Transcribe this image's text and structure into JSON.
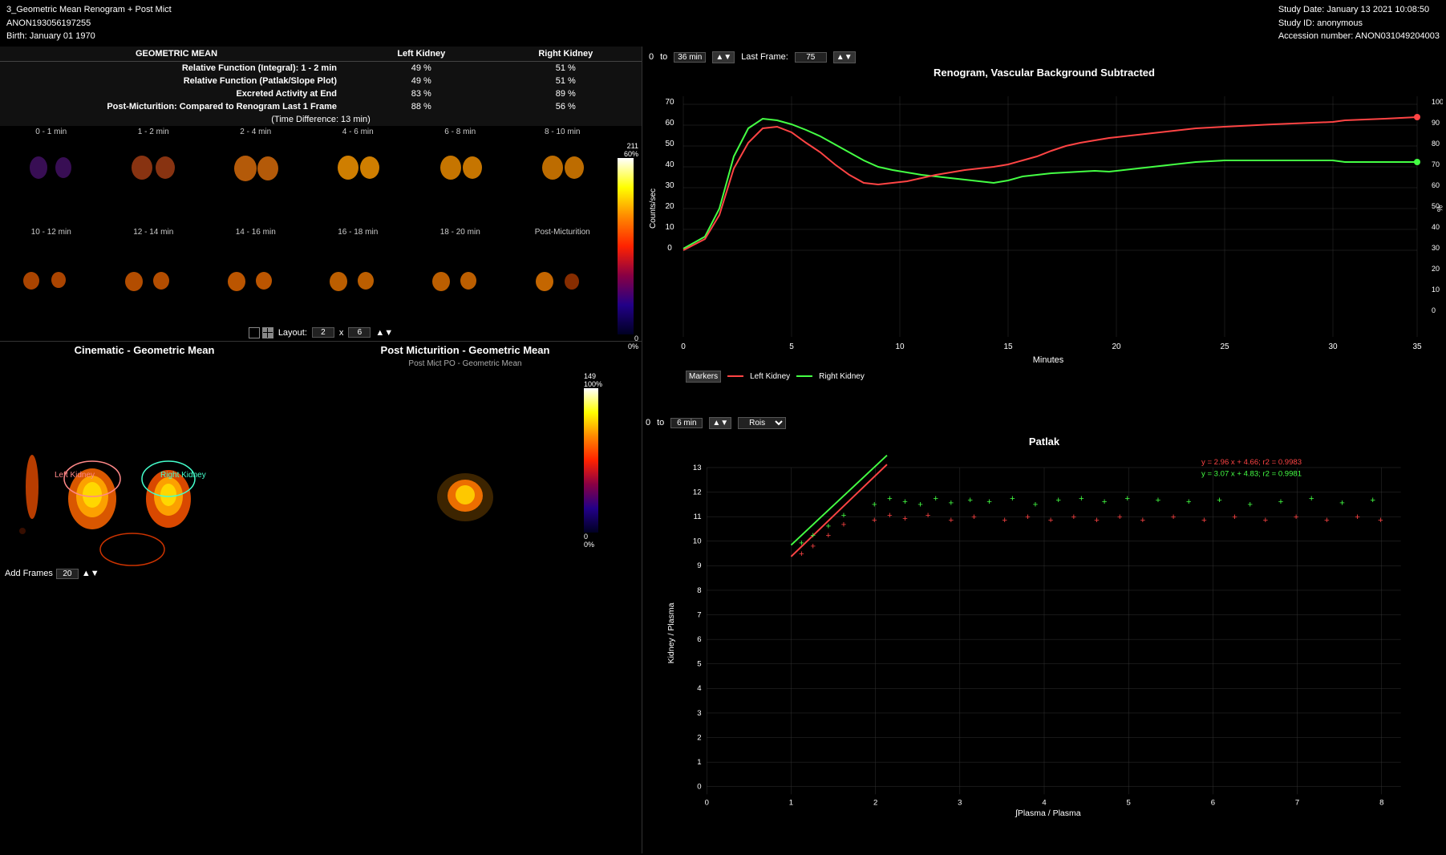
{
  "header": {
    "title": "3_Geometric Mean Renogram + Post Mict",
    "patient_id": "ANON193056197255",
    "birth": "Birth: January 01 1970",
    "study_date": "Study Date: January 13 2021 10:08:50",
    "study_id": "Study ID: anonymous",
    "accession": "Accession number: ANON031049204003"
  },
  "stats": {
    "title": "GEOMETRIC MEAN",
    "col_left": "Left Kidney",
    "col_right": "Right Kidney",
    "rows": [
      {
        "label": "Relative Function (Integral): 1 - 2 min",
        "left": "49 %",
        "right": "51 %"
      },
      {
        "label": "Relative Function (Patlak/Slope Plot)",
        "left": "49 %",
        "right": "51 %"
      },
      {
        "label": "Excreted Activity at End",
        "left": "83 %",
        "right": "89 %"
      },
      {
        "label": "Post-Micturition: Compared to Renogram Last 1 Frame",
        "left": "88 %",
        "right": "56 %"
      }
    ],
    "time_diff": "(Time Difference: 13 min)"
  },
  "frame_labels_row1": [
    "0 - 1 min",
    "1 - 2 min",
    "2 - 4 min",
    "4 - 6 min",
    "6 - 8 min",
    "8 - 10 min"
  ],
  "frame_labels_row2": [
    "10 - 12 min",
    "12 - 14 min",
    "14 - 16 min",
    "16 - 18 min",
    "18 - 20 min",
    "Post-Micturition"
  ],
  "color_scale_max": "211",
  "color_scale_pct": "60%",
  "color_scale_min": "0",
  "color_scale_0pct": "0%",
  "layout": {
    "label": "Layout:",
    "rows": "2",
    "cols": "6"
  },
  "cinematic": {
    "title": "Cinematic - Geometric Mean",
    "add_frames_label": "Add Frames",
    "add_frames_value": "20",
    "left_kidney_label": "Left Kidney",
    "right_kidney_label": "Right Kidney"
  },
  "post_mict": {
    "title": "Post Micturition - Geometric Mean",
    "subtitle": "Post Mict PO - Geometric Mean",
    "scale_max": "149",
    "scale_pct": "100%",
    "scale_min": "0",
    "scale_0pct": "0%"
  },
  "renogram": {
    "title": "Renogram, Vascular Background Subtracted",
    "range_start": "0",
    "range_end": "36 min",
    "last_frame_label": "Last Frame:",
    "last_frame_value": "75",
    "y_axis_left": "Counts/sec",
    "y_axis_right": "%",
    "x_axis": "Minutes",
    "legend_markers": "Markers",
    "legend_left": "Left Kidney",
    "legend_right": "Right Kidney"
  },
  "patlak_controls": {
    "range_start": "0",
    "range_end": "6 min",
    "dropdown": "Rois"
  },
  "patlak": {
    "title": "Patlak",
    "x_axis": "∫Plasma / Plasma",
    "y_axis": "Kidney / Plasma",
    "eq_left": "y = 2.96 x + 4.66; r2 = 0.9983",
    "eq_right": "y = 3.07 x + 4.83; r2 = 0.9981"
  }
}
